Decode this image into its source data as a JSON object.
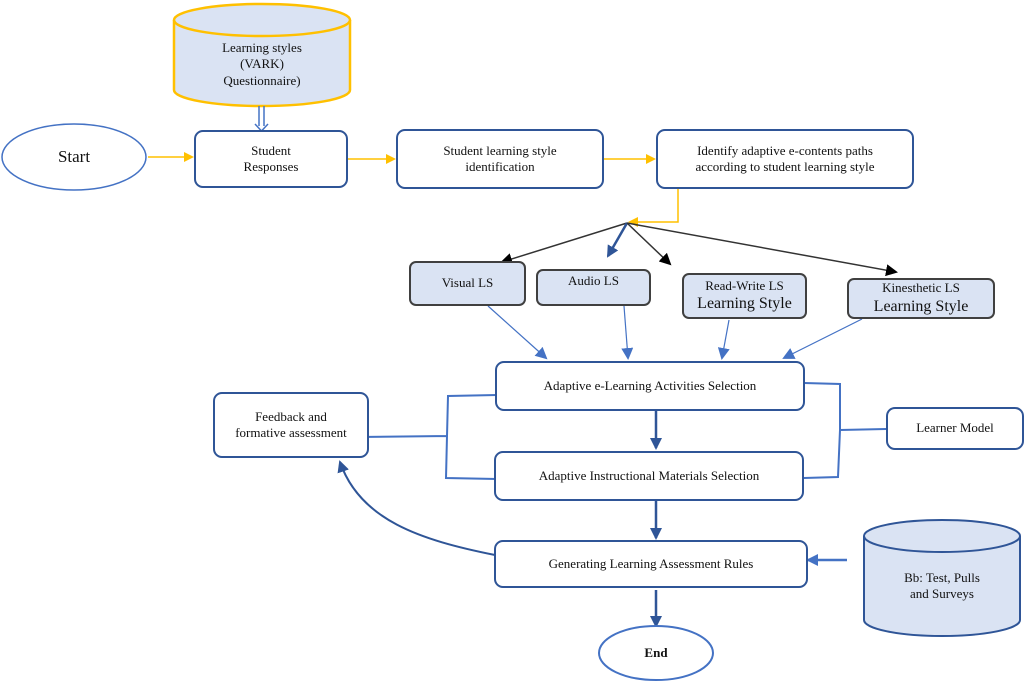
{
  "diagram": {
    "colors": {
      "primary_blue": "#2f5597",
      "light_blue": "#4472c4",
      "yellow": "#ffc000",
      "fill_light": "#dae3f3",
      "dark": "#404040"
    },
    "questionnaire_db": {
      "lines": [
        "Learning styles",
        "(VARK)",
        "Questionnaire)"
      ]
    },
    "start": {
      "label": "Start"
    },
    "student_responses": {
      "lines": [
        "Student",
        "Responses"
      ]
    },
    "ls_identification": {
      "lines": [
        "Student learning style",
        "identification"
      ]
    },
    "identify_paths": {
      "lines": [
        "Identify adaptive e-contents paths",
        "according to student learning style"
      ]
    },
    "learning_styles": [
      {
        "line1": "Visual LS",
        "line2": ""
      },
      {
        "line1": "Audio LS",
        "line2": ""
      },
      {
        "line1": "Read-Write LS",
        "line2": "Learning Style"
      },
      {
        "line1": "Kinesthetic LS",
        "line2": "Learning Style"
      }
    ],
    "activities_selection": {
      "label": "Adaptive e-Learning Activities Selection"
    },
    "materials_selection": {
      "label": "Adaptive Instructional Materials Selection"
    },
    "feedback": {
      "lines": [
        "Feedback and",
        "formative assessment"
      ]
    },
    "learner_model": {
      "label": "Learner Model"
    },
    "assessment_rules": {
      "label": "Generating Learning Assessment Rules"
    },
    "bb_db": {
      "lines": [
        "Bb: Test, Pulls",
        "and Surveys"
      ]
    },
    "end": {
      "label": "End"
    }
  }
}
